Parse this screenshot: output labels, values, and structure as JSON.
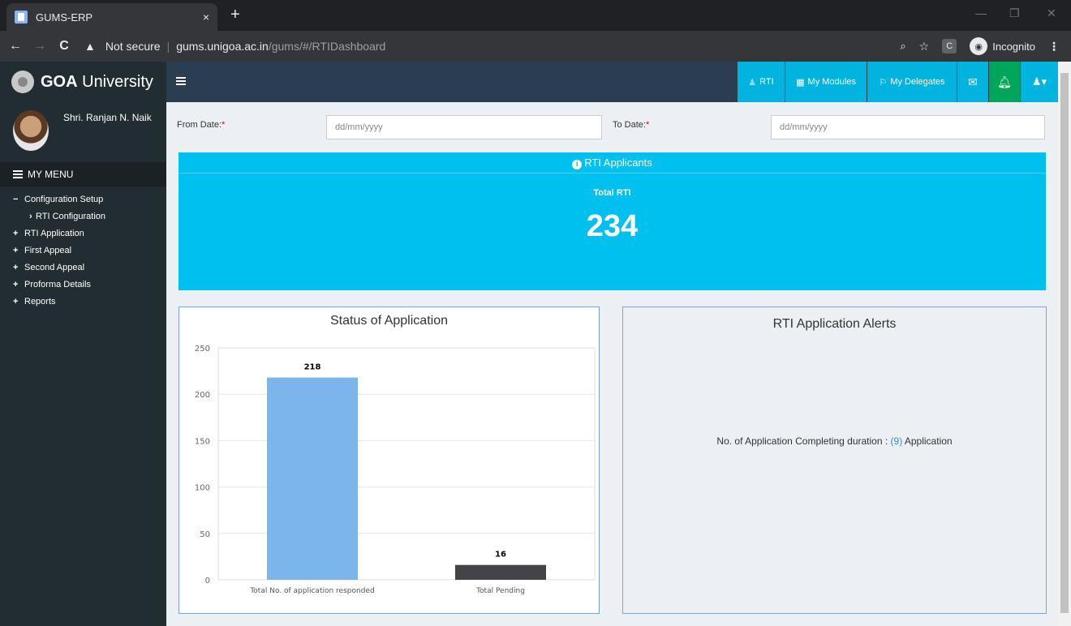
{
  "browser": {
    "tab_title": "GUMS-ERP",
    "tab_close": "×",
    "new_tab": "+",
    "not_secure": "Not secure",
    "url_host": "gums.unigoa.ac.in",
    "url_path": "/gums/#/RTIDashboard",
    "profile": "Incognito",
    "ext_label": "C"
  },
  "brand": {
    "name_bold": "GOA",
    "name_rest": " University"
  },
  "user": {
    "name": "Shri. Ranjan N. Naik"
  },
  "menu": {
    "header": "MY MENU",
    "items": [
      {
        "sign": "−",
        "label": "Configuration Setup"
      },
      {
        "sign": "›",
        "label": "RTI Configuration"
      },
      {
        "sign": "+",
        "label": "RTI Application"
      },
      {
        "sign": "+",
        "label": "First Appeal"
      },
      {
        "sign": "+",
        "label": "Second Appeal"
      },
      {
        "sign": "+",
        "label": "Proforma Details"
      },
      {
        "sign": "+",
        "label": "Reports"
      }
    ]
  },
  "topnav": {
    "rti": "RTI",
    "modules": "My Modules",
    "delegates": "My Delegates"
  },
  "filters": {
    "from_label": "From Date:",
    "to_label": "To Date:",
    "required_mark": "*",
    "from_placeholder": "dd/mm/yyyy",
    "to_placeholder": "dd/mm/yyyy"
  },
  "summary": {
    "header": "RTI Applicants",
    "label": "Total RTI",
    "total": "234"
  },
  "status_panel": {
    "title": "Status of Application"
  },
  "alerts_panel": {
    "title": "RTI Application Alerts",
    "msg_pre": "No. of Application Completing duration : ",
    "msg_count": "(9)",
    "msg_post": " Application"
  },
  "chart_data": {
    "type": "bar",
    "categories": [
      "Total No. of application responded",
      "Total Pending"
    ],
    "values": [
      218,
      16
    ],
    "bar_colors": [
      "#7cb5ec",
      "#434348"
    ],
    "ylim": [
      0,
      250
    ],
    "yticks": [
      0,
      50,
      100,
      150,
      200,
      250
    ],
    "grid": true
  },
  "colors": {
    "accent": "#00c0ef",
    "sidebar": "#222d32",
    "topnav": "#2b3d51",
    "green": "#00a65a"
  }
}
